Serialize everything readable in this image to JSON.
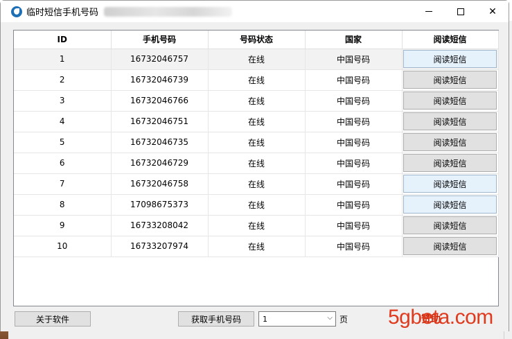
{
  "window": {
    "title": "临时短信手机号码",
    "controls": {
      "minimize": "—",
      "maximize": "☐",
      "close": "✕"
    }
  },
  "table": {
    "headers": [
      "ID",
      "手机号码",
      "号码状态",
      "国家",
      "阅读短信"
    ],
    "rows": [
      {
        "id": "1",
        "phone": "16732046757",
        "status": "在线",
        "country": "中国号码",
        "action": "阅读短信"
      },
      {
        "id": "2",
        "phone": "16732046739",
        "status": "在线",
        "country": "中国号码",
        "action": "阅读短信"
      },
      {
        "id": "3",
        "phone": "16732046766",
        "status": "在线",
        "country": "中国号码",
        "action": "阅读短信"
      },
      {
        "id": "4",
        "phone": "16732046751",
        "status": "在线",
        "country": "中国号码",
        "action": "阅读短信"
      },
      {
        "id": "5",
        "phone": "16732046735",
        "status": "在线",
        "country": "中国号码",
        "action": "阅读短信"
      },
      {
        "id": "6",
        "phone": "16732046729",
        "status": "在线",
        "country": "中国号码",
        "action": "阅读短信"
      },
      {
        "id": "7",
        "phone": "16732046758",
        "status": "在线",
        "country": "中国号码",
        "action": "阅读短信"
      },
      {
        "id": "8",
        "phone": "17098675373",
        "status": "在线",
        "country": "中国号码",
        "action": "阅读短信"
      },
      {
        "id": "9",
        "phone": "16733208042",
        "status": "在线",
        "country": "中国号码",
        "action": "阅读短信"
      },
      {
        "id": "10",
        "phone": "16733207974",
        "status": "在线",
        "country": "中国号码",
        "action": "阅读短信"
      }
    ]
  },
  "footer": {
    "about_label": "关于软件",
    "fetch_label": "获取手机号码",
    "page_value": "1",
    "page_unit": "页",
    "praise_label": "赞助"
  },
  "watermark": "5gbeta.com",
  "colors": {
    "watermark": "#e03a1e",
    "praise": "#cc2200",
    "app_icon": "#1f6fb5"
  }
}
